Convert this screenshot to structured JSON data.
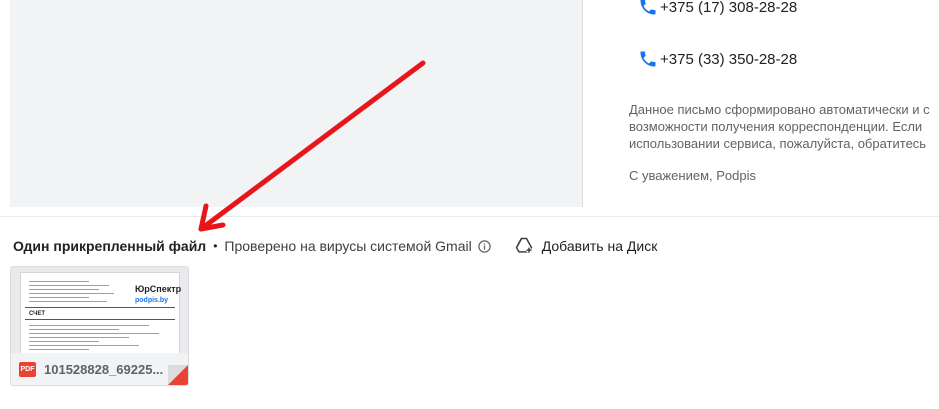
{
  "contacts": {
    "phone_1": "+375 (17) 308-28-28",
    "phone_2": "+375 (33) 350-28-28",
    "note_lines": [
      "Данное письмо сформировано автоматически и с",
      "возможности получения корреспонденции. Если",
      "использовании сервиса, пожалуйста, обратитесь"
    ],
    "regards": "С уважением, Podpis"
  },
  "attachments_bar": {
    "count_label": "Один прикрепленный файл",
    "separator": "•",
    "virus_check": "Проверено на вирусы системой Gmail",
    "add_to_drive": "Добавить на Диск"
  },
  "attachment": {
    "file_name": "101528828_69225...",
    "type_badge": "PDF",
    "preview": {
      "logo_brand": "ЮрСпектр",
      "logo_podpis": "podpis.by",
      "doc_title": "СЧЕТ"
    }
  },
  "colors": {
    "phone_icon": "#1a73e8",
    "pdf_red": "#ea4335",
    "arrow_red": "#e8161b"
  }
}
